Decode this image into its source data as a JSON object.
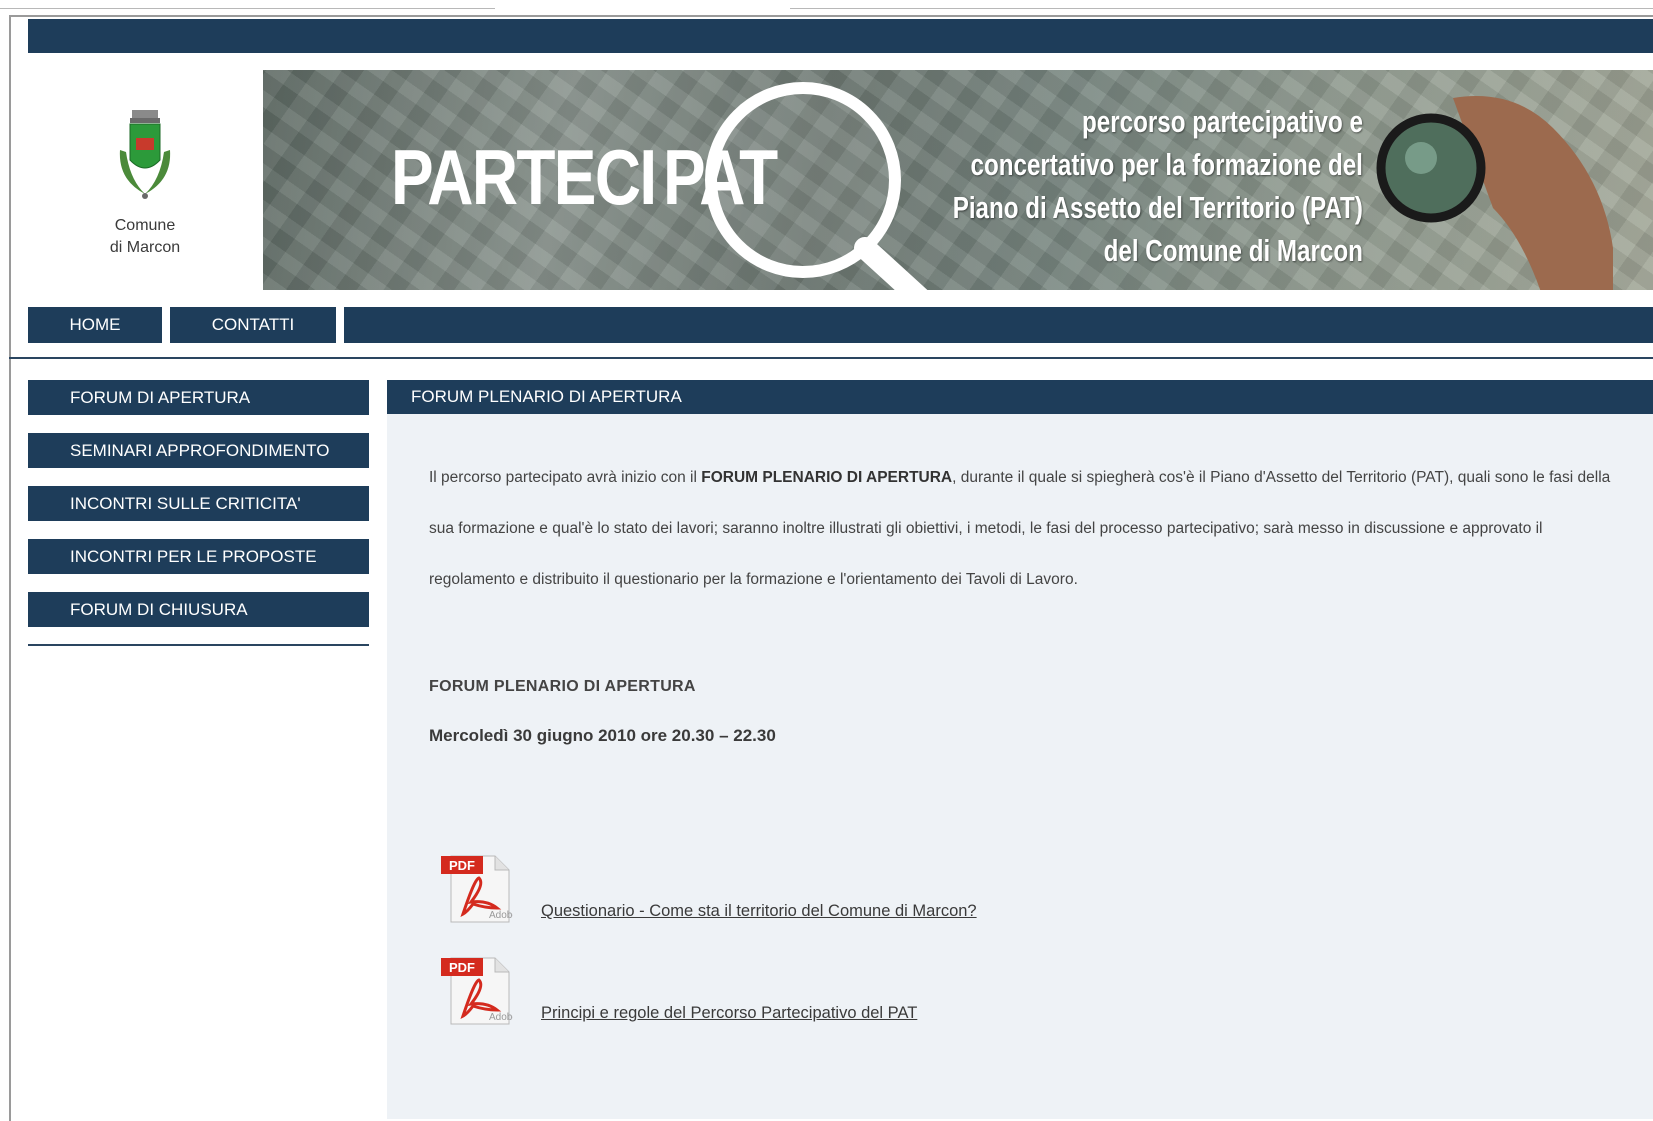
{
  "logo": {
    "line1": "Comune",
    "line2": "di Marcon"
  },
  "banner": {
    "brand_left": "PARTECI",
    "brand_right": "PAT",
    "tagline": [
      "percorso partecipativo e",
      "concertativo per la formazione del",
      "Piano di Assetto del Territorio (PAT)",
      "del Comune di Marcon"
    ]
  },
  "nav": {
    "home": "HOME",
    "contacts": "CONTATTI"
  },
  "sidebar": {
    "items": [
      "FORUM DI APERTURA",
      "SEMINARI APPROFONDIMENTO",
      "INCONTRI SULLE CRITICITA'",
      "INCONTRI PER LE PROPOSTE",
      "FORUM DI CHIUSURA"
    ]
  },
  "content": {
    "heading": "FORUM PLENARIO DI APERTURA",
    "para_before": "Il percorso partecipato avrà inizio con il ",
    "para_bold": "FORUM PLENARIO DI APERTURA",
    "para_after": ", durante il quale si spiegherà cos'è il Piano d'Assetto del Territorio (PAT), quali sono le fasi della sua formazione e qual'è lo stato dei lavori; saranno inoltre illustrati gli obiettivi, i metodi, le fasi del processo partecipativo; sarà messo in discussione e approvato il regolamento e distribuito il questionario per la formazione e l'orientamento dei Tavoli di Lavoro.",
    "subheading": "FORUM PLENARIO DI APERTURA",
    "date": "Mercoledì 30 giugno 2010 ore 20.30 – 22.30",
    "documents": [
      {
        "icon": "pdf-icon",
        "badge": "PDF",
        "brand": "Adobe",
        "label": "Questionario - Come sta il territorio del Comune di Marcon?"
      },
      {
        "icon": "pdf-icon",
        "badge": "PDF",
        "brand": "Adobe",
        "label": "Principi e regole del Percorso Partecipativo del PAT"
      }
    ]
  },
  "colors": {
    "navy": "#1e3d5a",
    "content_bg": "#eef2f6",
    "pdf_red": "#d42a1e"
  }
}
